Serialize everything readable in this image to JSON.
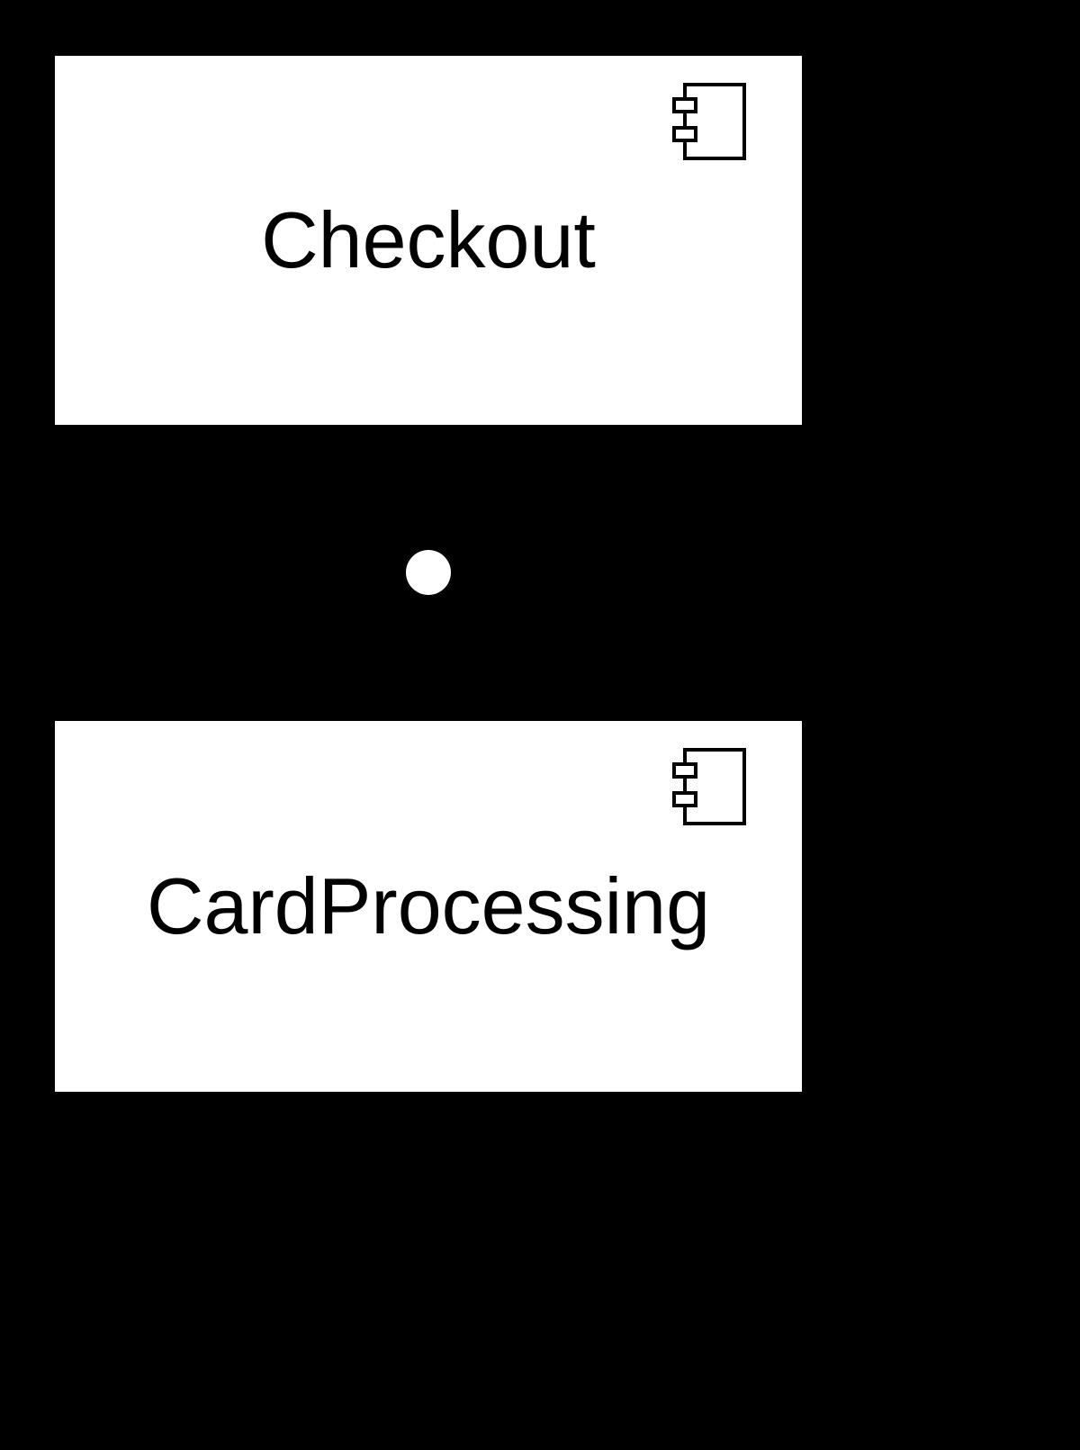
{
  "diagram": {
    "type": "uml-component",
    "components": [
      {
        "id": "checkout",
        "label": "Checkout"
      },
      {
        "id": "card-processing",
        "label": "CardProcessing"
      }
    ],
    "connector": {
      "kind": "provided-interface-lollipop",
      "from": "checkout",
      "to": "card-processing"
    }
  }
}
